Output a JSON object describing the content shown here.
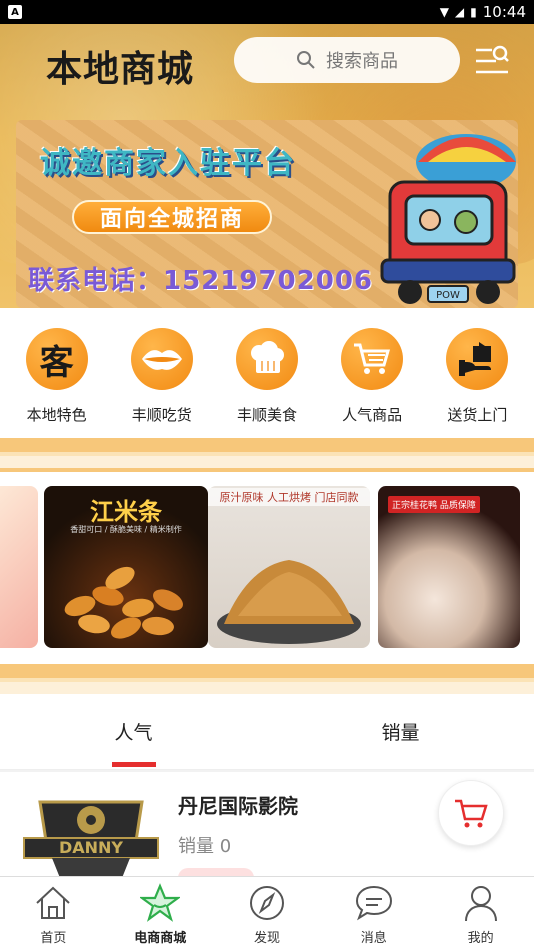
{
  "status_bar": {
    "app_badge": "A",
    "time": "10:44"
  },
  "header": {
    "title": "本地商城",
    "search_placeholder": "搜索商品"
  },
  "banner": {
    "headline": "诚邀商家入驻平台",
    "cta": "面向全城招商",
    "phone": "联系电话：15219702006",
    "art_caption": "POW"
  },
  "categories": [
    {
      "label": "本地特色",
      "icon": "客"
    },
    {
      "label": "丰顺吃货",
      "icon": "lips-icon"
    },
    {
      "label": "丰顺美食",
      "icon": "chef-hat-icon"
    },
    {
      "label": "人气商品",
      "icon": "cart-icon"
    },
    {
      "label": "送货上门",
      "icon": "delivery-box-icon"
    }
  ],
  "carousel": {
    "slides": [
      {
        "title": "江米条",
        "subtitle": "香甜可口 / 酥脆美味 / 精米制作"
      },
      {
        "title": "原汁原味 人工烘烤 门店同款"
      },
      {
        "title": "正宗桂花鸭 品质保障"
      }
    ]
  },
  "tabs": [
    {
      "label": "人气",
      "active": true
    },
    {
      "label": "销量",
      "active": false
    }
  ],
  "product": {
    "name": "丹尼国际影院",
    "sales": "销量 0",
    "logo_text": "DANNY"
  },
  "bottom_nav": [
    {
      "label": "首页",
      "icon": "home-icon",
      "active": false
    },
    {
      "label": "电商商城",
      "icon": "star-icon",
      "active": true
    },
    {
      "label": "发现",
      "icon": "compass-icon",
      "active": false
    },
    {
      "label": "消息",
      "icon": "chat-icon",
      "active": false
    },
    {
      "label": "我的",
      "icon": "user-icon",
      "active": false
    }
  ],
  "colors": {
    "accent": "#e52e2e",
    "orange": "#f28a12",
    "active_nav": "#2fae4b"
  }
}
